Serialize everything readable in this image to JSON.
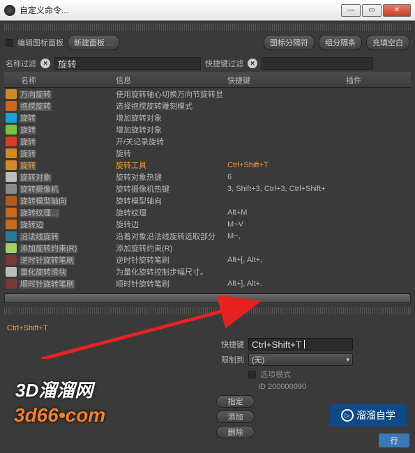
{
  "title": "自定义命令...",
  "toolbar": {
    "edit_icon_panel": "编辑图标面板",
    "new_panel": "新建面板 ...",
    "icon_sep": "图标分隔符",
    "group_sep": "组分隔条",
    "fill_blank": "充填空白"
  },
  "filters": {
    "name_filter_label": "名称过滤",
    "name_filter_value": "旋转",
    "sc_filter_label": "快捷键过滤",
    "sc_filter_value": ""
  },
  "columns": {
    "name": "名称",
    "info": "信息",
    "shortcut": "快捷键",
    "plugin": "插件"
  },
  "rows": [
    {
      "ic": "#d08a2a",
      "nm": "万向旋转",
      "inf": "使用旋转轴心切换万向节旋转显",
      "sc": ""
    },
    {
      "ic": "#c56a1e",
      "nm": "抱搅旋转",
      "inf": "选择抱搅旋转雕刻模式",
      "sc": ""
    },
    {
      "ic": "#1aa3d6",
      "nm": "旋转",
      "inf": "增加旋转对象",
      "sc": ""
    },
    {
      "ic": "#79c142",
      "nm": "旋转",
      "inf": "增加旋转对象",
      "sc": ""
    },
    {
      "ic": "#d43d2a",
      "nm": "旋转",
      "inf": "开/关记录旋转",
      "sc": ""
    },
    {
      "ic": "#d08a2a",
      "nm": "旋转",
      "inf": "旋转",
      "sc": ""
    },
    {
      "ic": "#d08a2a",
      "nm": "旋转",
      "inf": "旋转工具",
      "sc": "Ctrl+Shift+T",
      "sel": true
    },
    {
      "ic": "#bcbcbc",
      "nm": "旋转对象",
      "inf": "旋转对象热键",
      "sc": "6"
    },
    {
      "ic": "#8a8a8a",
      "nm": "旋转摄像机",
      "inf": "旋转摄像机热键",
      "sc": "3, Shift+3, Ctrl+3, Ctrl+Shift+"
    },
    {
      "ic": "#b45a1a",
      "nm": "旋转模型轴向",
      "inf": "旋转模型轴向",
      "sc": ""
    },
    {
      "ic": "#c56a1e",
      "nm": "旋转纹理…",
      "inf": "旋转纹理",
      "sc": "Alt+M"
    },
    {
      "ic": "#c56a1e",
      "nm": "旋转边",
      "inf": "旋转边",
      "sc": "M~V"
    },
    {
      "ic": "#2a7a9a",
      "nm": "沿法线旋转",
      "inf": "沿着对象沿法线旋转选取部分",
      "sc": "M~,"
    },
    {
      "ic": "#a4d06a",
      "nm": "添加旋转约束(R)",
      "inf": "添加旋转约束(R)",
      "sc": ""
    },
    {
      "ic": "#7a3a3a",
      "nm": "逆时针旋转笔刷",
      "inf": "逆时针旋转笔刷",
      "sc": "Alt+[, Alt+,"
    },
    {
      "ic": "#bcbcbc",
      "nm": "量化旋转滑块",
      "inf": "为量化旋转控制步幅尺寸。",
      "sc": ""
    },
    {
      "ic": "#7a3a3a",
      "nm": "顺时针旋转笔刷",
      "inf": "顺时针旋转笔刷",
      "sc": "Alt+], Alt+."
    }
  ],
  "detail": {
    "title": "Ctrl+Shift+T",
    "shortcut_label": "快捷键",
    "shortcut_value": "Ctrl+Shift+T",
    "restrict_label": "限制到",
    "restrict_value": "(无)",
    "option_mode": "选项模式",
    "id_label": "ID 200000090",
    "assign": "指定",
    "add": "添加",
    "delete": "删除",
    "run": "行"
  },
  "watermark": {
    "line1": "3D溜溜网",
    "line2": "3d66•com",
    "brand": "溜溜自学"
  }
}
